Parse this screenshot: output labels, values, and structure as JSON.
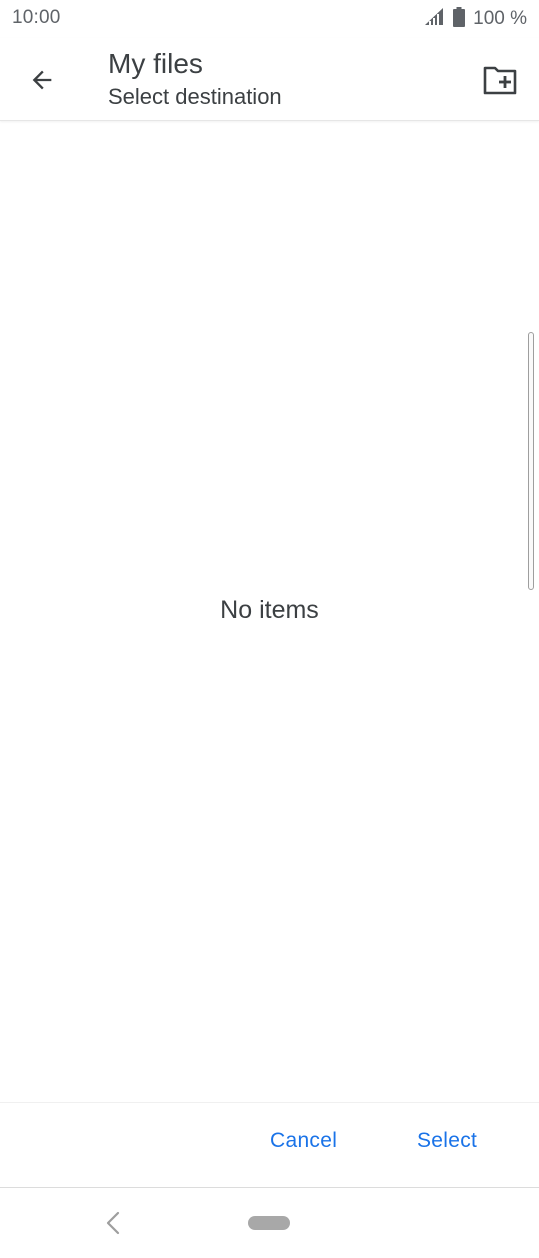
{
  "status_bar": {
    "time": "10:00",
    "battery": "100 %",
    "icons": [
      "signal-icon",
      "battery-icon"
    ]
  },
  "app_bar": {
    "title": "My files",
    "subtitle": "Select destination",
    "icons": [
      "arrow-back-icon",
      "new-folder-icon"
    ]
  },
  "content": {
    "empty_message": "No items"
  },
  "actions": {
    "cancel_label": "Cancel",
    "select_label": "Select"
  },
  "colors": {
    "accent": "#1a73e8",
    "text": "#3c4043",
    "status_text": "#5f6368"
  }
}
